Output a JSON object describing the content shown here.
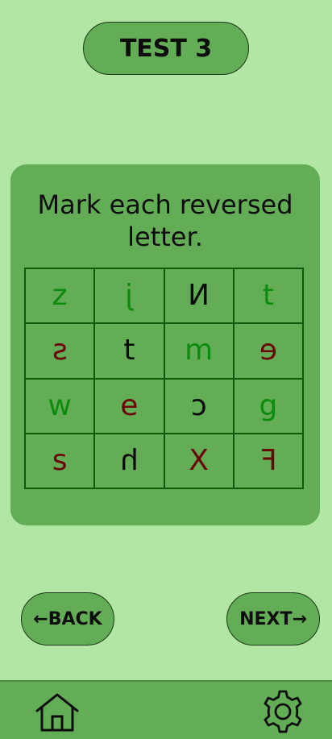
{
  "header": {
    "title": "TEST 3"
  },
  "card": {
    "instruction": "Mark each reversed letter.",
    "grid": [
      {
        "letter": "z",
        "color": "#0c8b0f",
        "reversed": false
      },
      {
        "letter": "j",
        "color": "#0c8b0f",
        "reversed": true
      },
      {
        "letter": "N",
        "color": "#0a0a0a",
        "reversed": true
      },
      {
        "letter": "t",
        "color": "#0c8b0f",
        "reversed": false
      },
      {
        "letter": "s",
        "color": "#6b0606",
        "reversed": true
      },
      {
        "letter": "t",
        "color": "#0a0a0a",
        "reversed": false
      },
      {
        "letter": "m",
        "color": "#0c8b0f",
        "reversed": false
      },
      {
        "letter": "e",
        "color": "#6b0606",
        "reversed": true
      },
      {
        "letter": "w",
        "color": "#0c8b0f",
        "reversed": false
      },
      {
        "letter": "e",
        "color": "#6b0606",
        "reversed": false
      },
      {
        "letter": "c",
        "color": "#0a0a0a",
        "reversed": true
      },
      {
        "letter": "g",
        "color": "#0c8b0f",
        "reversed": false
      },
      {
        "letter": "s",
        "color": "#6b0606",
        "reversed": false
      },
      {
        "letter": "h",
        "color": "#0a0a0a",
        "reversed": true
      },
      {
        "letter": "X",
        "color": "#6b0606",
        "reversed": false
      },
      {
        "letter": "F",
        "color": "#6b0606",
        "reversed": true
      }
    ]
  },
  "nav": {
    "back_label": "BACK",
    "next_label": "NEXT",
    "back_arrow": "←",
    "next_arrow": "→"
  },
  "bottom_bar": {
    "home_icon": "home-icon",
    "settings_icon": "gear-icon"
  },
  "colors": {
    "background": "#b1e6a4",
    "panel": "#62ad55",
    "grid_line": "#0f5a0a"
  }
}
